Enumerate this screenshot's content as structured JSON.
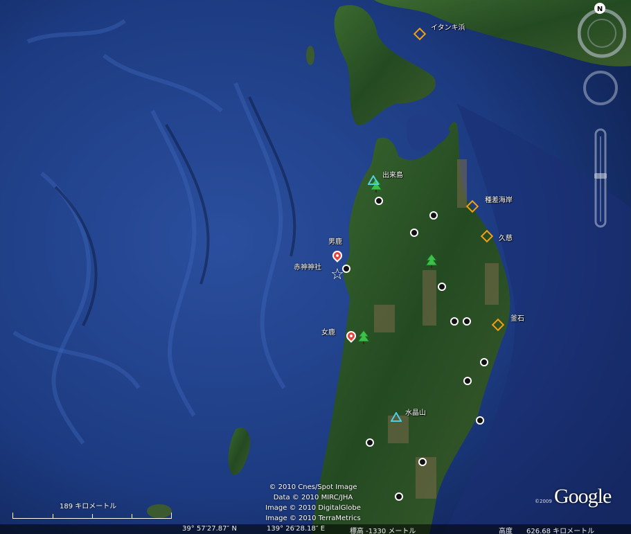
{
  "places": {
    "itanki": "イタンキ浜",
    "dekijima": "出来島",
    "tanesashi": "種差海岸",
    "kuji": "久慈",
    "oga": "男鹿",
    "akagami": "赤神神社",
    "kamaishi": "釜石",
    "mega": "女鹿",
    "suishozan": "水晶山"
  },
  "attribution": {
    "line1": "© 2010 Cnes/Spot Image",
    "line2": "Data © 2010 MIRC/JHA",
    "line3": "Image © 2010 DigitalGlobe",
    "line4": "Image © 2010 TerraMetrics"
  },
  "scale": {
    "label": "189 キロメートル"
  },
  "status": {
    "lat": "39° 57′27.87″ N",
    "lon": "139° 26′28.18″ E",
    "elevation": "標高 -1330 メートル",
    "altitude_label": "高度",
    "altitude_value": "626.68 キロメートル"
  },
  "logo": {
    "text": "Google",
    "copyright": "©2009"
  },
  "compass": {
    "north_label": "N"
  },
  "colors": {
    "ocean": "#1e3f8a",
    "land": "#2d5a2a",
    "pin": "#e8413a",
    "diamond": "#f0a010",
    "tree": "#3cc04a",
    "triangle": "#4fd0e0"
  }
}
